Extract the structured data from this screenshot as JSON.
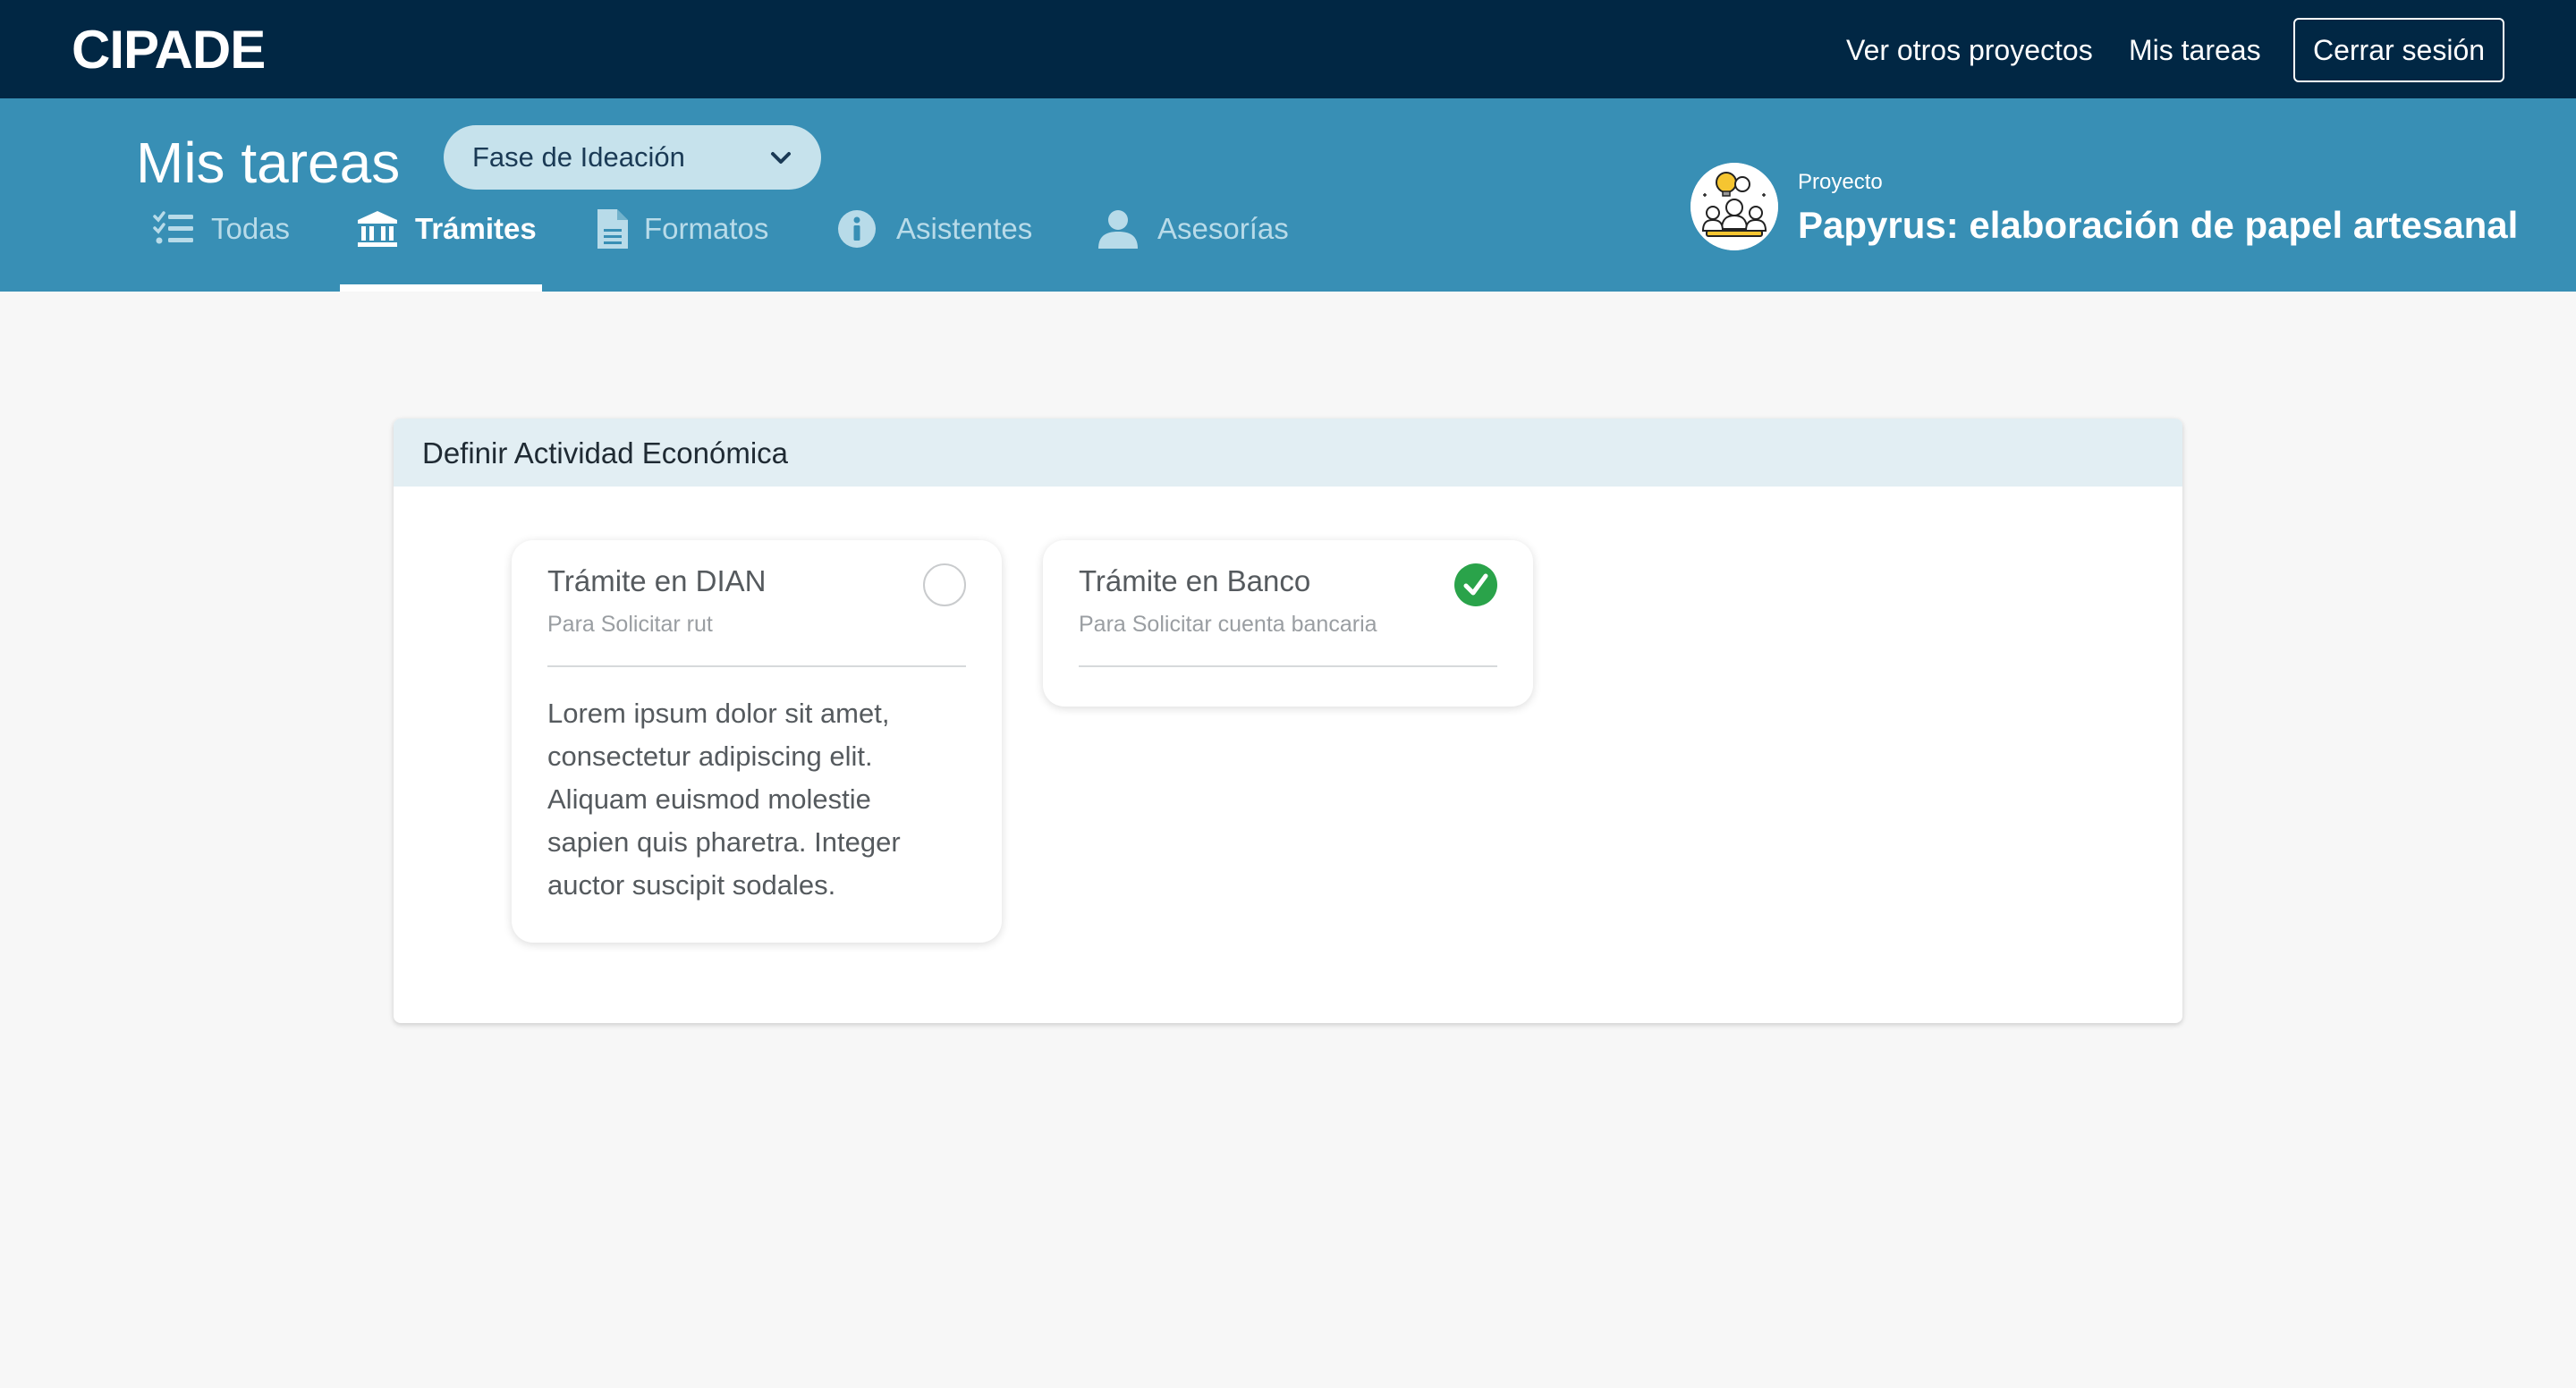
{
  "app": {
    "brand": "CIPADE"
  },
  "topnav": {
    "other_projects": "Ver otros proyectos",
    "my_tasks": "Mis tareas",
    "logout": "Cerrar sesión"
  },
  "header": {
    "title": "Mis tareas",
    "phase_select": {
      "selected": "Fase de Ideación"
    },
    "tabs": [
      {
        "label": "Todas",
        "icon": "checklist-icon",
        "active": false
      },
      {
        "label": "Trámites",
        "icon": "bank-icon",
        "active": true
      },
      {
        "label": "Formatos",
        "icon": "document-icon",
        "active": false
      },
      {
        "label": "Asistentes",
        "icon": "info-icon",
        "active": false
      },
      {
        "label": "Asesorías",
        "icon": "user-icon",
        "active": false
      }
    ],
    "project": {
      "caption": "Proyecto",
      "name": "Papyrus: elaboración de papel artesanal"
    }
  },
  "main": {
    "section_title": "Definir Actividad Económica",
    "tasks": [
      {
        "title": "Trámite en DIAN",
        "subtitle": "Para Solicitar rut",
        "description": "Lorem ipsum dolor sit amet, consectetur adipiscing elit. Aliquam euismod molestie sapien quis pharetra. Integer auctor suscipit sodales.",
        "completed": false
      },
      {
        "title": "Trámite en Banco",
        "subtitle": "Para Solicitar cuenta bancaria",
        "description": "",
        "completed": true
      }
    ]
  },
  "colors": {
    "navbar": "#012744",
    "subheader": "#388fb5",
    "tab_inactive": "#b8dbe9",
    "panel_header": "#e2eef3",
    "success": "#2aa34a"
  }
}
